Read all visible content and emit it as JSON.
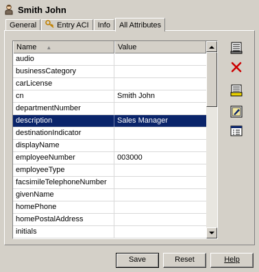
{
  "header": {
    "title": "Smith John",
    "icon": "user-icon"
  },
  "tabs": [
    {
      "label": "General",
      "active": false
    },
    {
      "label": "Entry ACI",
      "active": false,
      "icon": "key-icon"
    },
    {
      "label": "Info",
      "active": false
    },
    {
      "label": "All Attributes",
      "active": true
    }
  ],
  "table": {
    "columns": {
      "name": "Name",
      "value": "Value"
    },
    "rows": [
      {
        "name": "audio",
        "value": ""
      },
      {
        "name": "businessCategory",
        "value": ""
      },
      {
        "name": "carLicense",
        "value": ""
      },
      {
        "name": "cn",
        "value": "Smith John"
      },
      {
        "name": "departmentNumber",
        "value": ""
      },
      {
        "name": "description",
        "value": "Sales Manager",
        "selected": true
      },
      {
        "name": "destinationIndicator",
        "value": ""
      },
      {
        "name": "displayName",
        "value": ""
      },
      {
        "name": "employeeNumber",
        "value": "003000"
      },
      {
        "name": "employeeType",
        "value": ""
      },
      {
        "name": "facsimileTelephoneNumber",
        "value": ""
      },
      {
        "name": "givenName",
        "value": ""
      },
      {
        "name": "homePhone",
        "value": ""
      },
      {
        "name": "homePostalAddress",
        "value": ""
      },
      {
        "name": "initials",
        "value": ""
      }
    ]
  },
  "side_buttons": [
    "add-attribute-icon",
    "delete-icon",
    "edit-attribute-icon",
    "edit-value-icon",
    "properties-icon"
  ],
  "footer": {
    "save_label": "Save",
    "reset_label": "Reset",
    "help_label": "Help"
  },
  "colors": {
    "selection": "#0a246a",
    "face": "#d4d0c8",
    "delete": "#cc0000"
  }
}
